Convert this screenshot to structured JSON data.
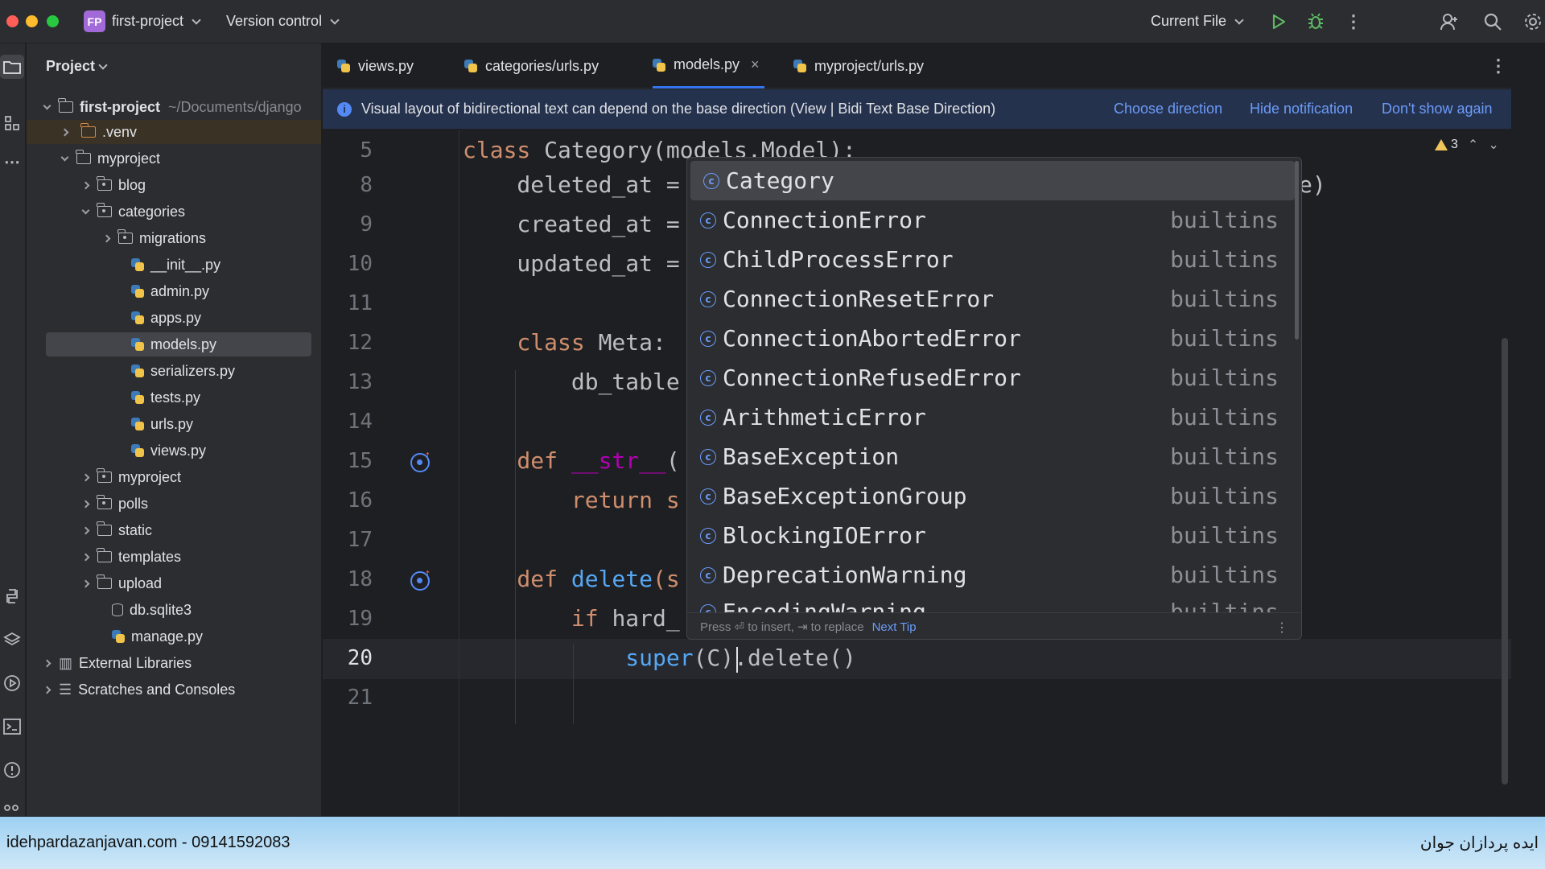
{
  "titlebar": {
    "project_badge": "FP",
    "project_name": "first-project",
    "vcs": "Version control",
    "run_config": "Current File",
    "icons": [
      "play-icon",
      "debug-icon",
      "more-vert-icon",
      "add-user-icon",
      "search-icon",
      "settings-icon"
    ]
  },
  "project_panel": {
    "title": "Project",
    "root": {
      "label": "first-project",
      "path": "~/Documents/django"
    },
    "items": [
      {
        "label": ".venv"
      },
      {
        "label": "myproject"
      },
      {
        "label": "blog"
      },
      {
        "label": "categories"
      },
      {
        "label": "migrations"
      },
      {
        "label": "__init__.py"
      },
      {
        "label": "admin.py"
      },
      {
        "label": "apps.py"
      },
      {
        "label": "models.py"
      },
      {
        "label": "serializers.py"
      },
      {
        "label": "tests.py"
      },
      {
        "label": "urls.py"
      },
      {
        "label": "views.py"
      },
      {
        "label": "myproject"
      },
      {
        "label": "polls"
      },
      {
        "label": "static"
      },
      {
        "label": "templates"
      },
      {
        "label": "upload"
      },
      {
        "label": "db.sqlite3"
      },
      {
        "label": "manage.py"
      },
      {
        "label": "External Libraries"
      },
      {
        "label": "Scratches and Consoles"
      }
    ]
  },
  "tabs": [
    {
      "label": "views.py"
    },
    {
      "label": "categories/urls.py"
    },
    {
      "label": "models.py",
      "close": "×"
    },
    {
      "label": "myproject/urls.py"
    }
  ],
  "notification": {
    "message": "Visual layout of bidirectional text can depend on the base direction (View | Bidi Text Base Direction)",
    "actions": [
      "Choose direction",
      "Hide notification",
      "Don't show again"
    ]
  },
  "editor": {
    "warning_count": "3",
    "lines": [
      {
        "num": "5",
        "parts": [
          {
            "t": "class ",
            "c": "kw"
          },
          {
            "t": "Category(models.Model):",
            "c": ""
          }
        ]
      },
      {
        "num": "8",
        "parts": [
          {
            "t": "    deleted_at = ",
            "c": ""
          },
          {
            "t": "e)",
            "c": "tail"
          }
        ]
      },
      {
        "num": "9",
        "parts": [
          {
            "t": "    created_at = ",
            "c": ""
          }
        ]
      },
      {
        "num": "10",
        "parts": [
          {
            "t": "    updated_at = ",
            "c": ""
          }
        ]
      },
      {
        "num": "11",
        "parts": []
      },
      {
        "num": "12",
        "parts": [
          {
            "t": "    class ",
            "c": "kw"
          },
          {
            "t": "Meta:",
            "c": ""
          }
        ]
      },
      {
        "num": "13",
        "parts": [
          {
            "t": "        db_table",
            "c": ""
          }
        ]
      },
      {
        "num": "14",
        "parts": []
      },
      {
        "num": "15",
        "parts": [
          {
            "t": "    def ",
            "c": "kw"
          },
          {
            "t": "__str__",
            "c": "dunder"
          },
          {
            "t": "(",
            "c": ""
          }
        ]
      },
      {
        "num": "16",
        "parts": [
          {
            "t": "        return ",
            "c": "kw"
          },
          {
            "t": "s",
            "c": "kw"
          }
        ]
      },
      {
        "num": "17",
        "parts": []
      },
      {
        "num": "18",
        "parts": [
          {
            "t": "    def ",
            "c": "kw"
          },
          {
            "t": "delete",
            "c": "fn"
          },
          {
            "t": "(s",
            "c": "kw"
          }
        ]
      },
      {
        "num": "19",
        "parts": [
          {
            "t": "        if ",
            "c": "kw"
          },
          {
            "t": "hard_",
            "c": ""
          }
        ]
      },
      {
        "num": "20",
        "parts": [
          {
            "t": "            super",
            "c": "fn"
          },
          {
            "t": "(C).delete()",
            "c": ""
          }
        ]
      },
      {
        "num": "21",
        "parts": []
      }
    ]
  },
  "completion": {
    "items": [
      {
        "name": "Category",
        "source": ""
      },
      {
        "name": "ConnectionError",
        "source": "builtins"
      },
      {
        "name": "ChildProcessError",
        "source": "builtins"
      },
      {
        "name": "ConnectionResetError",
        "source": "builtins"
      },
      {
        "name": "ConnectionAbortedError",
        "source": "builtins"
      },
      {
        "name": "ConnectionRefusedError",
        "source": "builtins"
      },
      {
        "name": "ArithmeticError",
        "source": "builtins"
      },
      {
        "name": "BaseException",
        "source": "builtins"
      },
      {
        "name": "BaseExceptionGroup",
        "source": "builtins"
      },
      {
        "name": "BlockingIOError",
        "source": "builtins"
      },
      {
        "name": "DeprecationWarning",
        "source": "builtins"
      },
      {
        "name": "EncodingWarning",
        "source": "builtins"
      }
    ],
    "footer_hint": "Press ⏎ to insert, ⇥ to replace",
    "footer_link": "Next Tip"
  },
  "banner": {
    "left": "idehpardazanjavan.com - 09141592083",
    "right": "ایده پردازان جوان"
  },
  "colors": {
    "accent": "#3574f0",
    "keyword": "#cf8e6d",
    "function": "#56a8f5",
    "dunder": "#b200b2",
    "link": "#6b9bfa"
  }
}
